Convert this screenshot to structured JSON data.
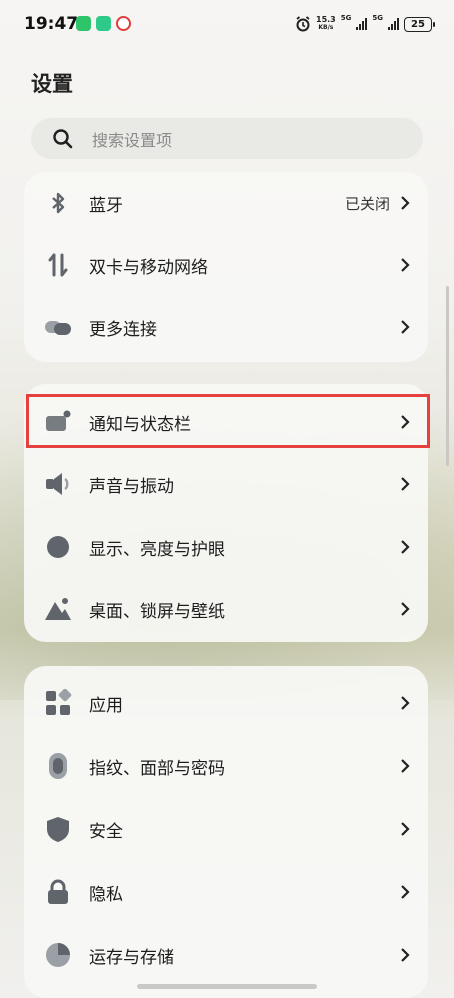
{
  "status_bar": {
    "time": "19:47",
    "net_speed_value": "15.3",
    "net_speed_unit": "KB/s",
    "net_type_1": "5G",
    "net_type_2": "5G",
    "battery": "25"
  },
  "header": {
    "title": "设置"
  },
  "search": {
    "placeholder": "搜索设置项"
  },
  "groups": [
    {
      "items": [
        {
          "label": "蓝牙",
          "value": "已关闭",
          "icon": "bluetooth-icon"
        },
        {
          "label": "双卡与移动网络",
          "icon": "dual-sim-icon"
        },
        {
          "label": "更多连接",
          "icon": "more-connections-icon"
        }
      ]
    },
    {
      "items": [
        {
          "label": "通知与状态栏",
          "icon": "notification-icon",
          "highlighted": true
        },
        {
          "label": "声音与振动",
          "icon": "speaker-icon"
        },
        {
          "label": "显示、亮度与护眼",
          "icon": "display-icon"
        },
        {
          "label": "桌面、锁屏与壁纸",
          "icon": "wallpaper-icon"
        }
      ]
    },
    {
      "items": [
        {
          "label": "应用",
          "icon": "apps-icon"
        },
        {
          "label": "指纹、面部与密码",
          "icon": "fingerprint-icon"
        },
        {
          "label": "安全",
          "icon": "shield-icon"
        },
        {
          "label": "隐私",
          "icon": "lock-icon"
        },
        {
          "label": "运存与存储",
          "icon": "storage-icon"
        }
      ]
    }
  ],
  "colors": {
    "highlight_border": "#e5413f",
    "icon_gray": "#666b70",
    "accent_app": "#2ec46a"
  }
}
